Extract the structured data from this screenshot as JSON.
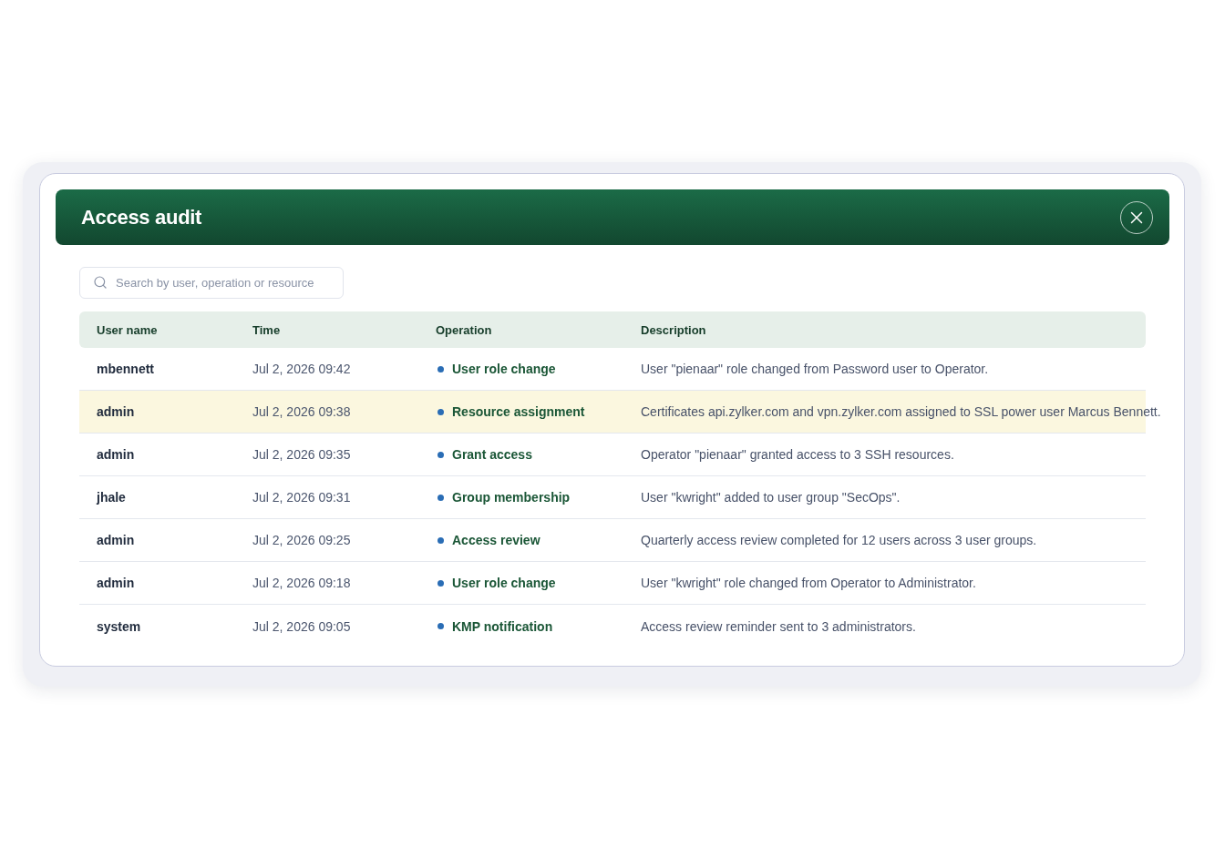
{
  "dialog": {
    "title": "Access audit"
  },
  "search": {
    "placeholder": "Search by user, operation or resource"
  },
  "table": {
    "columns": [
      "User name",
      "Time",
      "Operation",
      "Description"
    ],
    "rows": [
      {
        "user_name": "mbennett",
        "time": "Jul 2, 2026 09:42",
        "operation": "User role change",
        "description": "User \"pienaar\" role changed from Password user to Operator.",
        "selected": false
      },
      {
        "user_name": "admin",
        "time": "Jul 2, 2026 09:38",
        "operation": "Resource assignment",
        "description": "Certificates api.zylker.com and vpn.zylker.com assigned to SSL power user Marcus Bennett.",
        "selected": true
      },
      {
        "user_name": "admin",
        "time": "Jul 2, 2026 09:35",
        "operation": "Grant access",
        "description": "Operator \"pienaar\" granted access to 3 SSH resources.",
        "selected": false
      },
      {
        "user_name": "jhale",
        "time": "Jul 2, 2026 09:31",
        "operation": "Group membership",
        "description": "User \"kwright\" added to user group \"SecOps\".",
        "selected": false
      },
      {
        "user_name": "admin",
        "time": "Jul 2, 2026 09:25",
        "operation": "Access review",
        "description": "Quarterly access review completed for 12 users across 3 user groups.",
        "selected": false
      },
      {
        "user_name": "admin",
        "time": "Jul 2, 2026 09:18",
        "operation": "User role change",
        "description": "User \"kwright\" role changed from Operator to Administrator.",
        "selected": false
      },
      {
        "user_name": "system",
        "time": "Jul 2, 2026 09:05",
        "operation": "KMP notification",
        "description": "Access review reminder sent to 3 administrators.",
        "selected": false
      }
    ]
  }
}
